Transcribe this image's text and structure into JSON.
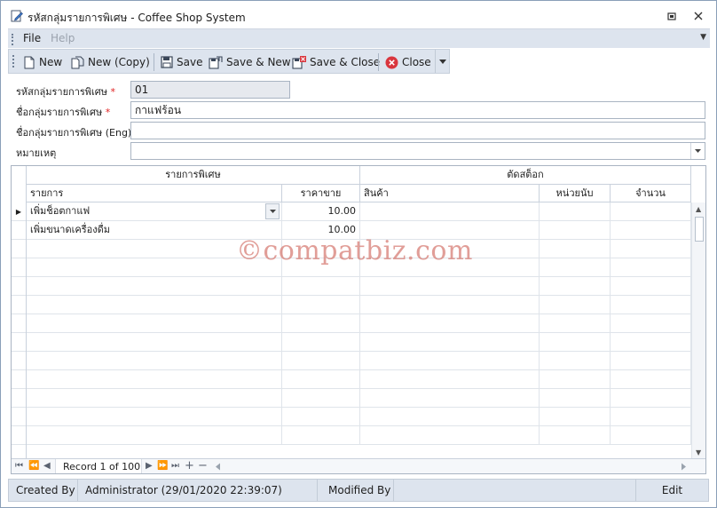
{
  "window": {
    "title": "รหัสกลุ่มรายการพิเศษ - Coffee Shop System",
    "title_icon": "edit-document-icon",
    "buttons": [
      "restore-icon",
      "close-icon"
    ]
  },
  "menu": {
    "items": [
      {
        "label": "File",
        "enabled": true
      },
      {
        "label": "Help",
        "enabled": false
      }
    ]
  },
  "toolbar": {
    "buttons": [
      {
        "label": "New",
        "icon": "new-document-icon"
      },
      {
        "label": "New (Copy)",
        "icon": "copy-document-icon"
      },
      {
        "label": "Save",
        "icon": "save-icon"
      },
      {
        "label": "Save & New",
        "icon": "save-new-icon"
      },
      {
        "label": "Save & Close",
        "icon": "save-close-icon"
      },
      {
        "label": "Close",
        "icon": "close-circle-icon"
      }
    ]
  },
  "form": {
    "code": {
      "label": "รหัสกลุ่มรายการพิเศษ",
      "required_mark": "*",
      "value": "01"
    },
    "name": {
      "label": "ชื่อกลุ่มรายการพิเศษ",
      "required_mark": "*",
      "value": "กาแฟร้อน"
    },
    "name_en": {
      "label": "ชื่อกลุ่มรายการพิเศษ (Eng)",
      "value": ""
    },
    "note": {
      "label": "หมายเหตุ",
      "value": ""
    }
  },
  "grid": {
    "bands": [
      "รายการพิเศษ",
      "ตัดสต็อก"
    ],
    "columns": [
      "รายการ",
      "ราคาขาย",
      "สินค้า",
      "หน่วยนับ",
      "จำนวน"
    ],
    "rows": [
      {
        "item": "เพิ่มช็อตกาแฟ",
        "price": "10.00",
        "product": "",
        "unit": "",
        "qty": "",
        "current": true
      },
      {
        "item": "เพิ่มขนาดเครื่องดื่ม",
        "price": "10.00",
        "product": "",
        "unit": "",
        "qty": "",
        "current": false
      }
    ],
    "navigator": {
      "record_text": "Record 1 of 100"
    }
  },
  "watermark": "©compatbiz.com",
  "status": {
    "created_by_label": "Created By",
    "created_by_value": "Administrator (29/01/2020 22:39:07)",
    "modified_by_label": "Modified By",
    "modified_by_value": "",
    "mode": "Edit"
  },
  "colors": {
    "toolbar_bg": "#dde4ee",
    "required": "#e02020",
    "close_icon": "#d9363e",
    "watermark": "#d67870"
  }
}
